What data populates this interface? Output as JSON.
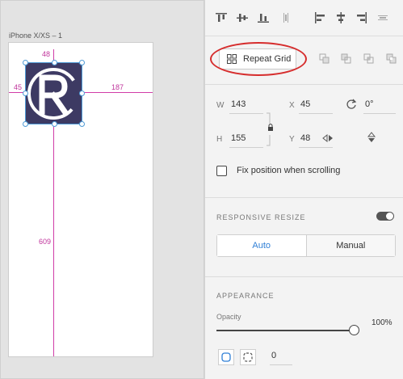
{
  "canvas": {
    "artboard_title": "iPhone X/XS – 1",
    "measurements": {
      "top": "48",
      "left": "45",
      "right": "187",
      "bottom": "609"
    },
    "guide_color": "#d13da8",
    "selection_color": "#4e9bd6",
    "logo": {
      "letter": "R",
      "background": "#3d3a63"
    }
  },
  "panel": {
    "align_icons": [
      "align-top-icon",
      "align-vertical-center-icon",
      "align-bottom-icon",
      "distribute-vertical-icon",
      "align-left-icon",
      "align-horizontal-center-icon",
      "align-right-icon",
      "distribute-horizontal-icon"
    ],
    "repeat_grid": {
      "label": "Repeat Grid",
      "highlight_color": "#d62d2d"
    },
    "boolean_icons": [
      "add-icon",
      "subtract-icon",
      "intersect-icon",
      "exclude-icon"
    ],
    "transform": {
      "w_label": "W",
      "w_value": "143",
      "h_label": "H",
      "h_value": "155",
      "x_label": "X",
      "x_value": "45",
      "y_label": "Y",
      "y_value": "48",
      "rotation": "0°"
    },
    "fix_position": "Fix position when scrolling",
    "responsive": {
      "title": "RESPONSIVE RESIZE",
      "enabled": true,
      "auto_label": "Auto",
      "manual_label": "Manual",
      "accent": "#2f7fd6"
    },
    "appearance": {
      "title": "APPEARANCE",
      "opacity_label": "Opacity",
      "opacity_value": "100%",
      "opacity_fraction": 1.0,
      "corner_value": "0"
    }
  }
}
